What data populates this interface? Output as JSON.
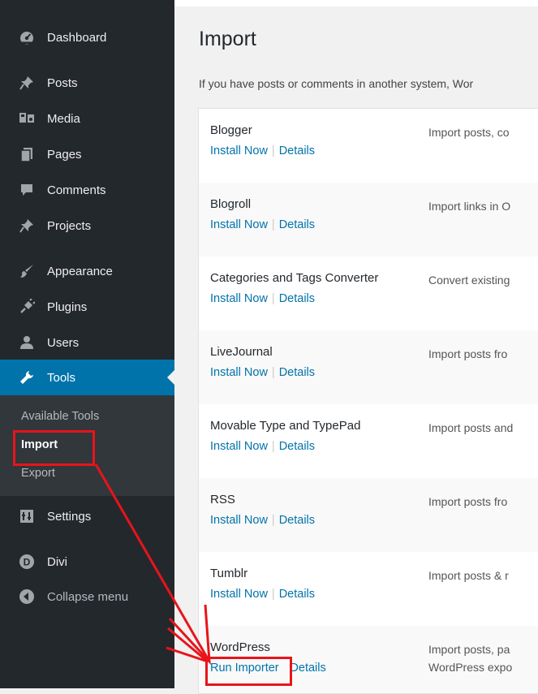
{
  "sidebar": {
    "items": [
      {
        "label": "Dashboard",
        "icon": "dashboard-icon"
      },
      {
        "label": "Posts",
        "icon": "pin-icon"
      },
      {
        "label": "Media",
        "icon": "media-icon"
      },
      {
        "label": "Pages",
        "icon": "pages-icon"
      },
      {
        "label": "Comments",
        "icon": "comment-icon"
      },
      {
        "label": "Projects",
        "icon": "pin-icon"
      },
      {
        "label": "Appearance",
        "icon": "brush-icon"
      },
      {
        "label": "Plugins",
        "icon": "plug-icon"
      },
      {
        "label": "Users",
        "icon": "user-icon"
      },
      {
        "label": "Tools",
        "icon": "wrench-icon"
      },
      {
        "label": "Settings",
        "icon": "settings-icon"
      },
      {
        "label": "Divi",
        "icon": "divi-icon"
      },
      {
        "label": "Collapse menu",
        "icon": "collapse-icon"
      }
    ],
    "submenu": [
      "Available Tools",
      "Import",
      "Export"
    ],
    "divi_letter": "D"
  },
  "main": {
    "title": "Import",
    "intro": "If you have posts or comments in another system, Wor",
    "importers": [
      {
        "name": "Blogger",
        "action": "Install Now",
        "details": "Details",
        "desc": "Import posts, co"
      },
      {
        "name": "Blogroll",
        "action": "Install Now",
        "details": "Details",
        "desc": "Import links in O"
      },
      {
        "name": "Categories and Tags Converter",
        "action": "Install Now",
        "details": "Details",
        "desc": "Convert existing"
      },
      {
        "name": "LiveJournal",
        "action": "Install Now",
        "details": "Details",
        "desc": "Import posts fro"
      },
      {
        "name": "Movable Type and TypePad",
        "action": "Install Now",
        "details": "Details",
        "desc": "Import posts and"
      },
      {
        "name": "RSS",
        "action": "Install Now",
        "details": "Details",
        "desc": "Import posts fro"
      },
      {
        "name": "Tumblr",
        "action": "Install Now",
        "details": "Details",
        "desc": "Import posts & r"
      },
      {
        "name": "WordPress",
        "action": "Run Importer",
        "details": "Details",
        "desc": "Import posts, pa",
        "desc2": "WordPress expo"
      }
    ],
    "separator": "|"
  },
  "colors": {
    "sidebar_bg": "#23282d",
    "submenu_bg": "#32373c",
    "active_bg": "#0073aa",
    "link": "#0073aa",
    "annotation": "#e8141a"
  }
}
